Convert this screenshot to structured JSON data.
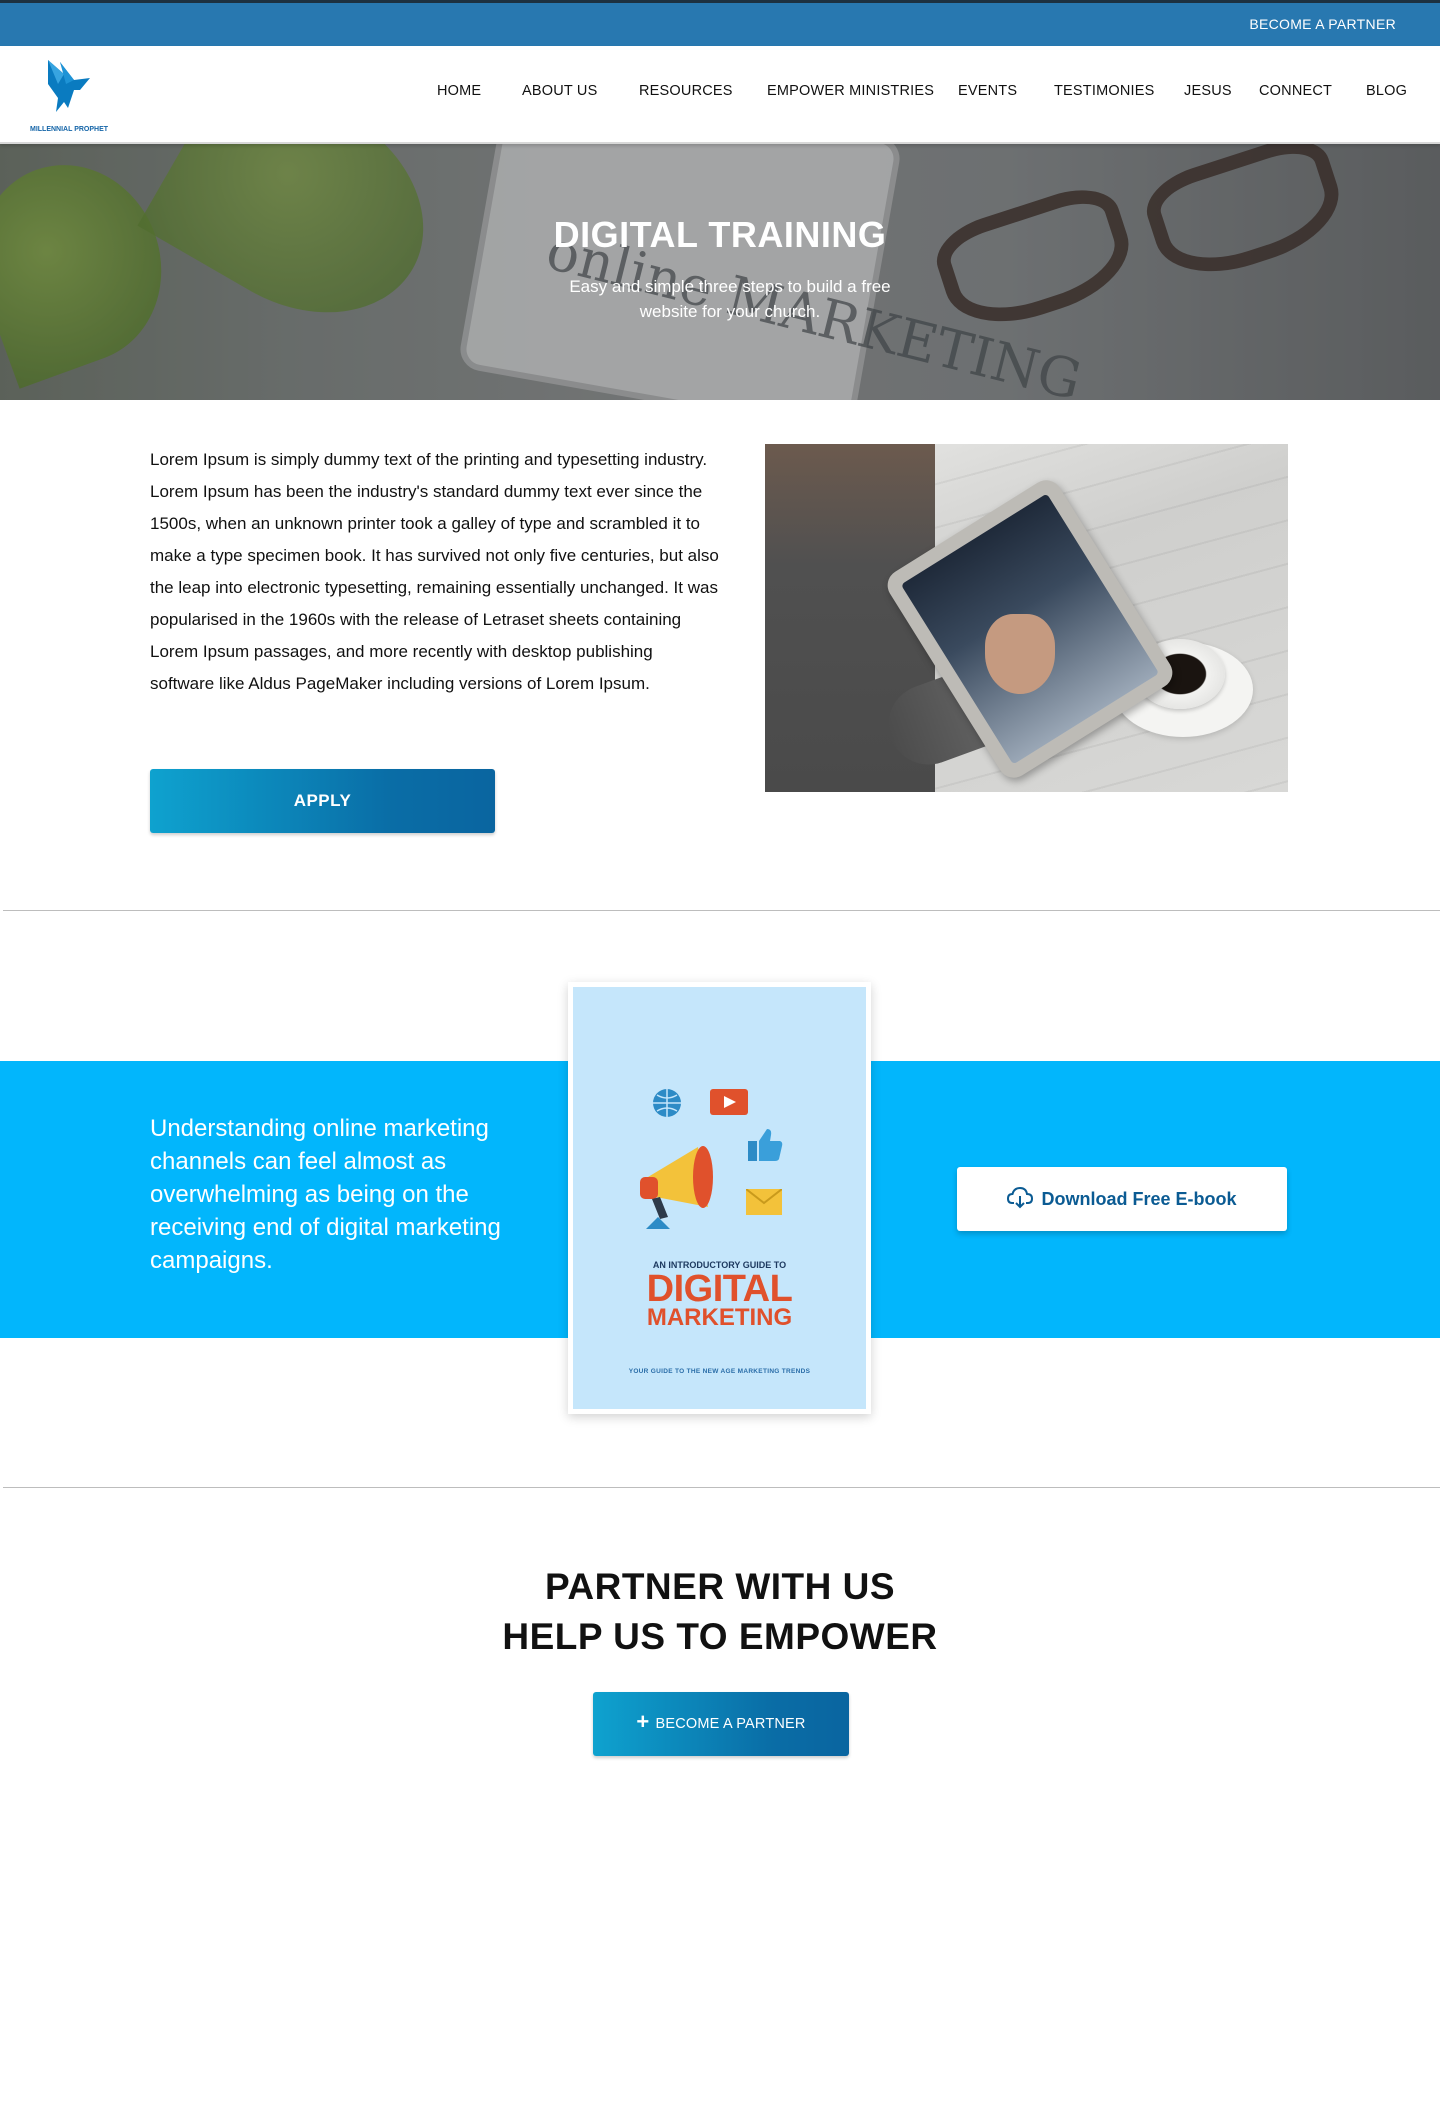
{
  "topbar": {
    "partner_label": "BECOME A PARTNER"
  },
  "brand": {
    "name": "MILLENNIAL PROPHET"
  },
  "nav": {
    "items": [
      "HOME",
      "ABOUT US",
      "RESOURCES",
      "EMPOWER MINISTRIES",
      "EVENTS",
      "TESTIMONIES",
      "JESUS",
      "CONNECT",
      "BLOG"
    ]
  },
  "hero": {
    "title": "DIGITAL TRAINING",
    "subtitle": "Easy and simple three steps to build a free website  for your church.",
    "background_text": "online MARKETING"
  },
  "intro": {
    "body": "Lorem Ipsum is simply dummy text of the printing and typesetting industry. Lorem Ipsum has been the industry's standard dummy text ever since the 1500s, when an unknown printer took a galley of type and scrambled it to make a type specimen book. It has survived not only five centuries, but also the leap into electronic typesetting, remaining essentially unchanged. It was popularised in the 1960s with the release of Letraset sheets containing Lorem Ipsum passages, and more recently with desktop publishing software like Aldus PageMaker including versions of Lorem Ipsum.",
    "apply_label": "APPLY"
  },
  "ebook": {
    "band_text": "Understanding online marketing channels can feel almost as overwhelming as being on the receiving end of digital marketing campaigns.",
    "cover_kicker": "AN INTRODUCTORY GUIDE TO",
    "cover_title_1": "DIGITAL",
    "cover_title_2": "MARKETING",
    "cover_footer": "YOUR GUIDE TO THE NEW AGE MARKETING TRENDS",
    "download_label": "Download Free E-book"
  },
  "partner": {
    "heading_line1": "PARTNER WITH US",
    "heading_line2": "HELP US TO EMPOWER",
    "button_label": "BECOME A PARTNER"
  },
  "colors": {
    "topbar": "#2878b0",
    "band": "#02b6fc",
    "button_start": "#0ea2cf",
    "button_end": "#0a65a0",
    "cover_title": "#e0512c"
  },
  "icons": {
    "logo": "bird-logo-icon",
    "download": "cloud-download-icon",
    "plus": "plus-icon"
  }
}
